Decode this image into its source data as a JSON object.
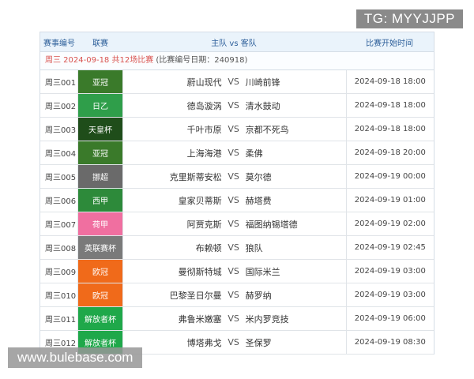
{
  "overlay": {
    "tg_text": "TG: MYYJJPP",
    "site_watermark": "www.bulebase.com"
  },
  "header": {
    "col_id": "赛事编号",
    "col_league": "联赛",
    "col_match": "主队 vs 客队",
    "col_time": "比赛开始时间"
  },
  "info": {
    "summary": "周三 2024-09-18 共12场比赛",
    "note": "(比赛编号日期：240918)"
  },
  "vs_label": "VS",
  "matches": [
    {
      "id": "周三001",
      "league": "亚冠",
      "league_color": "#3a7a2a",
      "home": "蔚山现代",
      "away": "川崎前锋",
      "time": "2024-09-18 18:00"
    },
    {
      "id": "周三002",
      "league": "日乙",
      "league_color": "#2f9e4a",
      "home": "德岛漩涡",
      "away": "清水鼓动",
      "time": "2024-09-18 18:00"
    },
    {
      "id": "周三003",
      "league": "天皇杯",
      "league_color": "#1f4d1a",
      "home": "千叶市原",
      "away": "京都不死鸟",
      "time": "2024-09-18 18:00"
    },
    {
      "id": "周三004",
      "league": "亚冠",
      "league_color": "#3a7a2a",
      "home": "上海海港",
      "away": "柔佛",
      "time": "2024-09-18 20:00"
    },
    {
      "id": "周三005",
      "league": "挪超",
      "league_color": "#6a6a6a",
      "home": "克里斯蒂安松",
      "away": "莫尔德",
      "time": "2024-09-19 00:00"
    },
    {
      "id": "周三006",
      "league": "西甲",
      "league_color": "#2d8a3a",
      "home": "皇家贝蒂斯",
      "away": "赫塔费",
      "time": "2024-09-19 01:00"
    },
    {
      "id": "周三007",
      "league": "荷甲",
      "league_color": "#f06fa0",
      "home": "阿贾克斯",
      "away": "福图纳锡塔德",
      "time": "2024-09-19 02:00"
    },
    {
      "id": "周三008",
      "league": "英联赛杯",
      "league_color": "#7a7a7a",
      "home": "布赖顿",
      "away": "狼队",
      "time": "2024-09-19 02:45"
    },
    {
      "id": "周三009",
      "league": "欧冠",
      "league_color": "#f06a1a",
      "home": "曼彻斯特城",
      "away": "国际米兰",
      "time": "2024-09-19 03:00"
    },
    {
      "id": "周三010",
      "league": "欧冠",
      "league_color": "#f06a1a",
      "home": "巴黎圣日尔曼",
      "away": "赫罗纳",
      "time": "2024-09-19 03:00"
    },
    {
      "id": "周三011",
      "league": "解放者杯",
      "league_color": "#1fa84a",
      "home": "弗鲁米嫩塞",
      "away": "米内罗竞技",
      "time": "2024-09-19 06:00"
    },
    {
      "id": "周三012",
      "league": "解放者杯",
      "league_color": "#1fa84a",
      "home": "博塔弗戈",
      "away": "圣保罗",
      "time": "2024-09-19 08:30"
    }
  ]
}
